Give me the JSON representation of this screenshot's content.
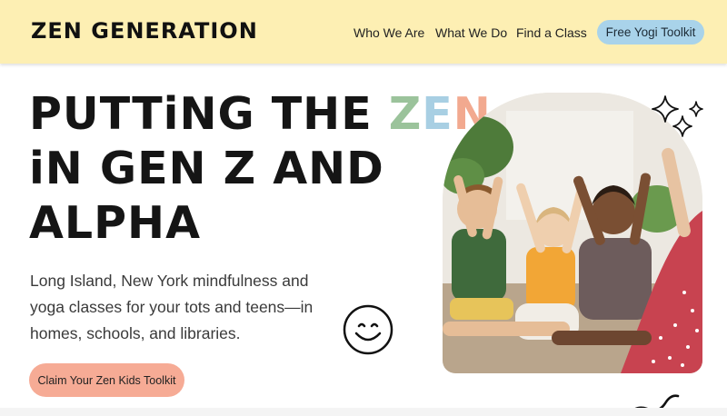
{
  "header": {
    "logo": "ZEN GENERATION",
    "nav": [
      "Who We Are",
      "What We Do",
      "Find a Class"
    ],
    "cta_label": "Free Yogi Toolkit"
  },
  "hero": {
    "line1_prefix": "PUTTiNG THE ",
    "zen_z": "Z",
    "zen_e": "E",
    "zen_n": "N",
    "line2": "iN GEN Z AND",
    "line3": "ALPHA",
    "subtitle": "Long Island, New York mindfulness and yoga classes for your tots and teens—in homes, schools, and libraries.",
    "button_label": "Claim Your Zen Kids Toolkit"
  },
  "icons": [
    "smiley-face-icon",
    "sparkles-icon",
    "squiggle-icon"
  ],
  "colors": {
    "header_bg": "#fdefb3",
    "nav_cta": "#a9d3ea",
    "hero_cta": "#f6ab95",
    "zen_green": "#9bc39b",
    "zen_blue": "#a8cfe3",
    "zen_peach": "#f2a98f"
  }
}
